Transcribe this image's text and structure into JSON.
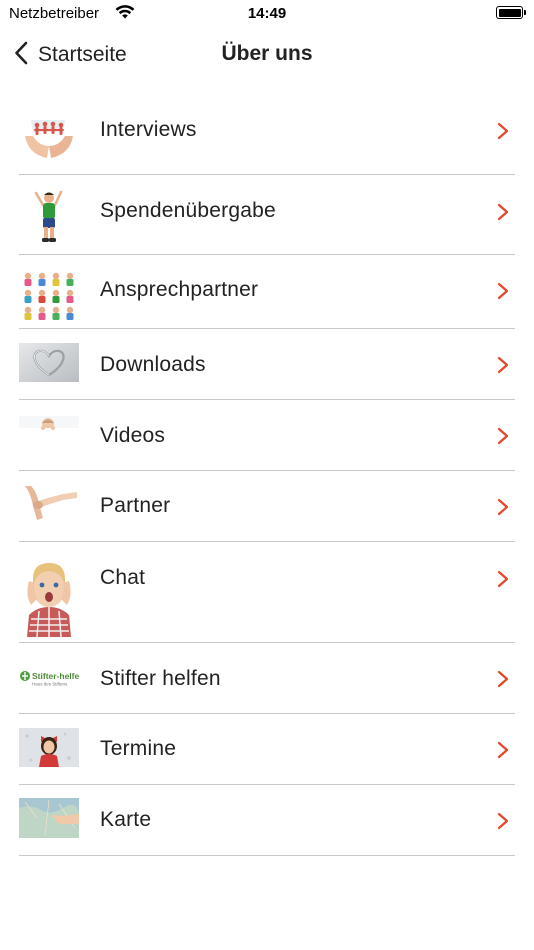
{
  "status_bar": {
    "carrier": "Netzbetreiber",
    "time": "14:49"
  },
  "nav": {
    "back_label": "Startseite",
    "title": "Über uns"
  },
  "accent_color": "#e2462a",
  "menu": [
    {
      "label": "Interviews",
      "icon": "paper-people-hands-icon"
    },
    {
      "label": "Spendenübergabe",
      "icon": "jumping-child-icon"
    },
    {
      "label": "Ansprechpartner",
      "icon": "children-collage-icon"
    },
    {
      "label": "Downloads",
      "icon": "sand-heart-icon"
    },
    {
      "label": "Videos",
      "icon": "baby-peeking-icon"
    },
    {
      "label": "Partner",
      "icon": "holding-hands-icon"
    },
    {
      "label": "Chat",
      "icon": "surprised-child-icon"
    },
    {
      "label": "Stifter helfen",
      "icon": "stifter-helfen-logo",
      "logo_text": "Stifter-helfen",
      "logo_subtext": "Haus des Stiftens"
    },
    {
      "label": "Termine",
      "icon": "girl-with-bow-icon"
    },
    {
      "label": "Karte",
      "icon": "map-pointing-icon"
    }
  ]
}
